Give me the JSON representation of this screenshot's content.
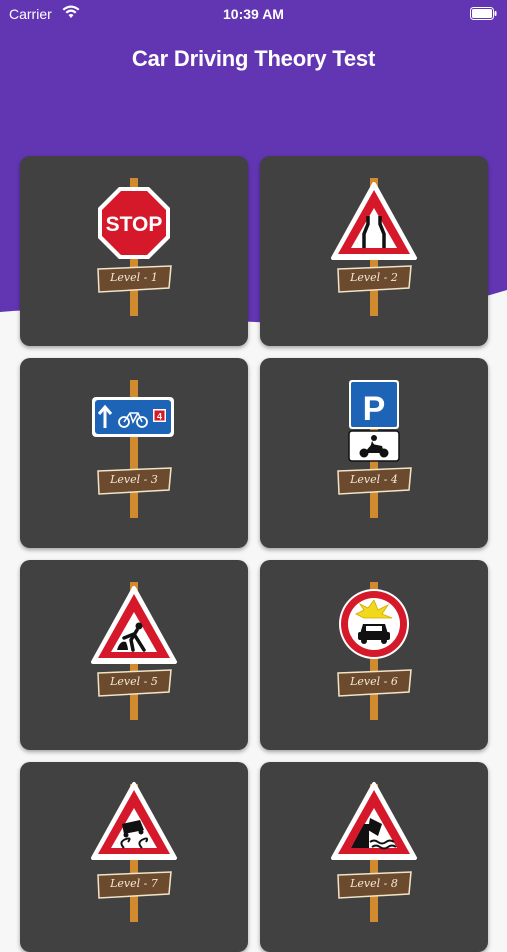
{
  "status_bar": {
    "carrier": "Carrier",
    "time": "10:39 AM"
  },
  "header": {
    "title": "Car Driving Theory Test",
    "background": "#6236b2"
  },
  "levels": [
    {
      "label": "Level - 1",
      "sign": "stop-sign-icon"
    },
    {
      "label": "Level - 2",
      "sign": "road-narrows-sign-icon"
    },
    {
      "label": "Level - 3",
      "sign": "cycle-lane-sign-icon"
    },
    {
      "label": "Level - 4",
      "sign": "motorcycle-parking-sign-icon"
    },
    {
      "label": "Level - 5",
      "sign": "roadworks-sign-icon"
    },
    {
      "label": "Level - 6",
      "sign": "no-explosives-sign-icon"
    },
    {
      "label": "Level - 7",
      "sign": "slippery-road-sign-icon"
    },
    {
      "label": "Level - 8",
      "sign": "quayside-sign-icon"
    }
  ],
  "sign_texts": {
    "stop": "STOP",
    "parking": "P",
    "lane_number": "4"
  },
  "colors": {
    "card": "#414141",
    "post": "#d28a2e",
    "plank": "#6b4a2e",
    "red": "#d5192b",
    "blue": "#1d63b6"
  }
}
